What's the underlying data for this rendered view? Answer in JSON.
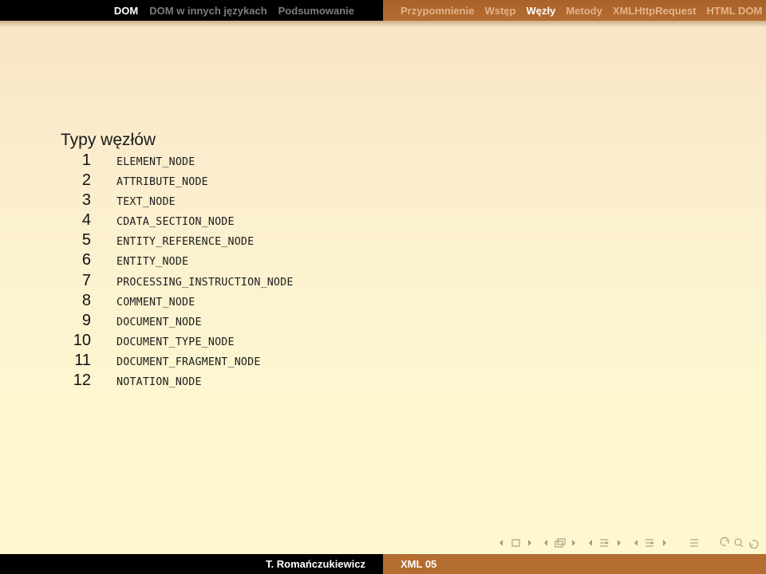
{
  "header": {
    "left_sections": [
      "DOM",
      "DOM w innych językach",
      "Podsumowanie"
    ],
    "right_sections": [
      "Przypomnienie",
      "Wstęp",
      "Węzły",
      "Metody",
      "XMLHttpRequest",
      "HTML DOM"
    ]
  },
  "slide": {
    "title": "Typy węzłów",
    "node_types": [
      {
        "num": "1",
        "name": "ELEMENT_NODE"
      },
      {
        "num": "2",
        "name": "ATTRIBUTE_NODE"
      },
      {
        "num": "3",
        "name": "TEXT_NODE"
      },
      {
        "num": "4",
        "name": "CDATA_SECTION_NODE"
      },
      {
        "num": "5",
        "name": "ENTITY_REFERENCE_NODE"
      },
      {
        "num": "6",
        "name": "ENTITY_NODE"
      },
      {
        "num": "7",
        "name": "PROCESSING_INSTRUCTION_NODE"
      },
      {
        "num": "8",
        "name": "COMMENT_NODE"
      },
      {
        "num": "9",
        "name": "DOCUMENT_NODE"
      },
      {
        "num": "10",
        "name": "DOCUMENT_TYPE_NODE"
      },
      {
        "num": "11",
        "name": "DOCUMENT_FRAGMENT_NODE"
      },
      {
        "num": "12",
        "name": "NOTATION_NODE"
      }
    ]
  },
  "footer": {
    "author": "T. Romańczukiewicz",
    "short_title": "XML 05"
  },
  "navigation_icons": [
    "prev-slide-icon",
    "slide-icon",
    "next-slide-icon",
    "prev-frame-icon",
    "frame-icon",
    "next-frame-icon",
    "prev-subsection-icon",
    "subsection-icon",
    "next-subsection-icon",
    "prev-section-icon",
    "section-icon",
    "next-section-icon",
    "align-icon",
    "back-icon",
    "search-icon",
    "forward-icon"
  ],
  "colors": {
    "header_left_bg": "#000000",
    "header_right_bg": "#b46c30",
    "active_link": "#ffffff",
    "inactive_left_link": "#7d7d7d",
    "inactive_right_link": "#e4b38a"
  }
}
